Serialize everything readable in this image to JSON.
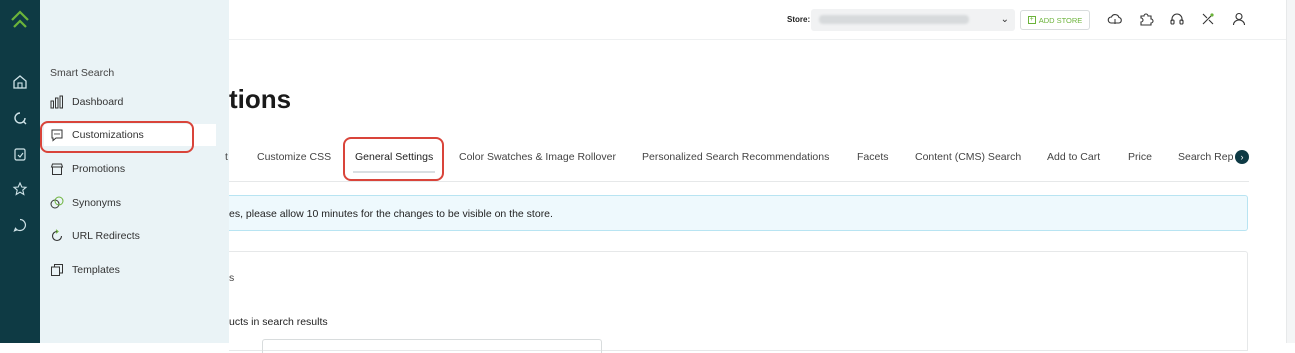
{
  "app": {
    "accent_color": "#6bb33a",
    "rail_color": "#0e3a44",
    "annotation_color": "#d9443a"
  },
  "rail": {
    "items": [
      {
        "icon": "home-icon"
      },
      {
        "icon": "smart-search-icon"
      },
      {
        "icon": "clipboard-icon"
      },
      {
        "icon": "star-icon"
      },
      {
        "icon": "chat-icon"
      }
    ]
  },
  "flyout": {
    "heading": "Smart Search",
    "items": [
      {
        "label": "Dashboard",
        "icon": "bar-chart-icon"
      },
      {
        "label": "Customizations",
        "icon": "chat-bubble-icon",
        "active": true
      },
      {
        "label": "Promotions",
        "icon": "store-icon"
      },
      {
        "label": "Synonyms",
        "icon": "synonyms-icon"
      },
      {
        "label": "URL Redirects",
        "icon": "redirect-icon"
      },
      {
        "label": "Templates",
        "icon": "templates-icon"
      }
    ]
  },
  "topbar": {
    "store_label": "Store:",
    "add_store_label": "ADD STORE",
    "icons": [
      "cloud-sync-icon",
      "puzzle-icon",
      "headset-icon",
      "integration-icon",
      "user-icon"
    ]
  },
  "main": {
    "title": "tions",
    "tabs": [
      {
        "label": "t"
      },
      {
        "label": "Customize CSS"
      },
      {
        "label": "General Settings",
        "active": true
      },
      {
        "label": "Color Swatches & Image Rollover"
      },
      {
        "label": "Personalized Search Recommendations"
      },
      {
        "label": "Facets"
      },
      {
        "label": "Content (CMS) Search"
      },
      {
        "label": "Add to Cart"
      },
      {
        "label": "Price"
      },
      {
        "label": "Search Rep"
      }
    ],
    "notice": "es, please allow 10 minutes for the changes to be visible on the store.",
    "card": {
      "fragment_1": "s",
      "fragment_2": "ucts in search results"
    }
  }
}
